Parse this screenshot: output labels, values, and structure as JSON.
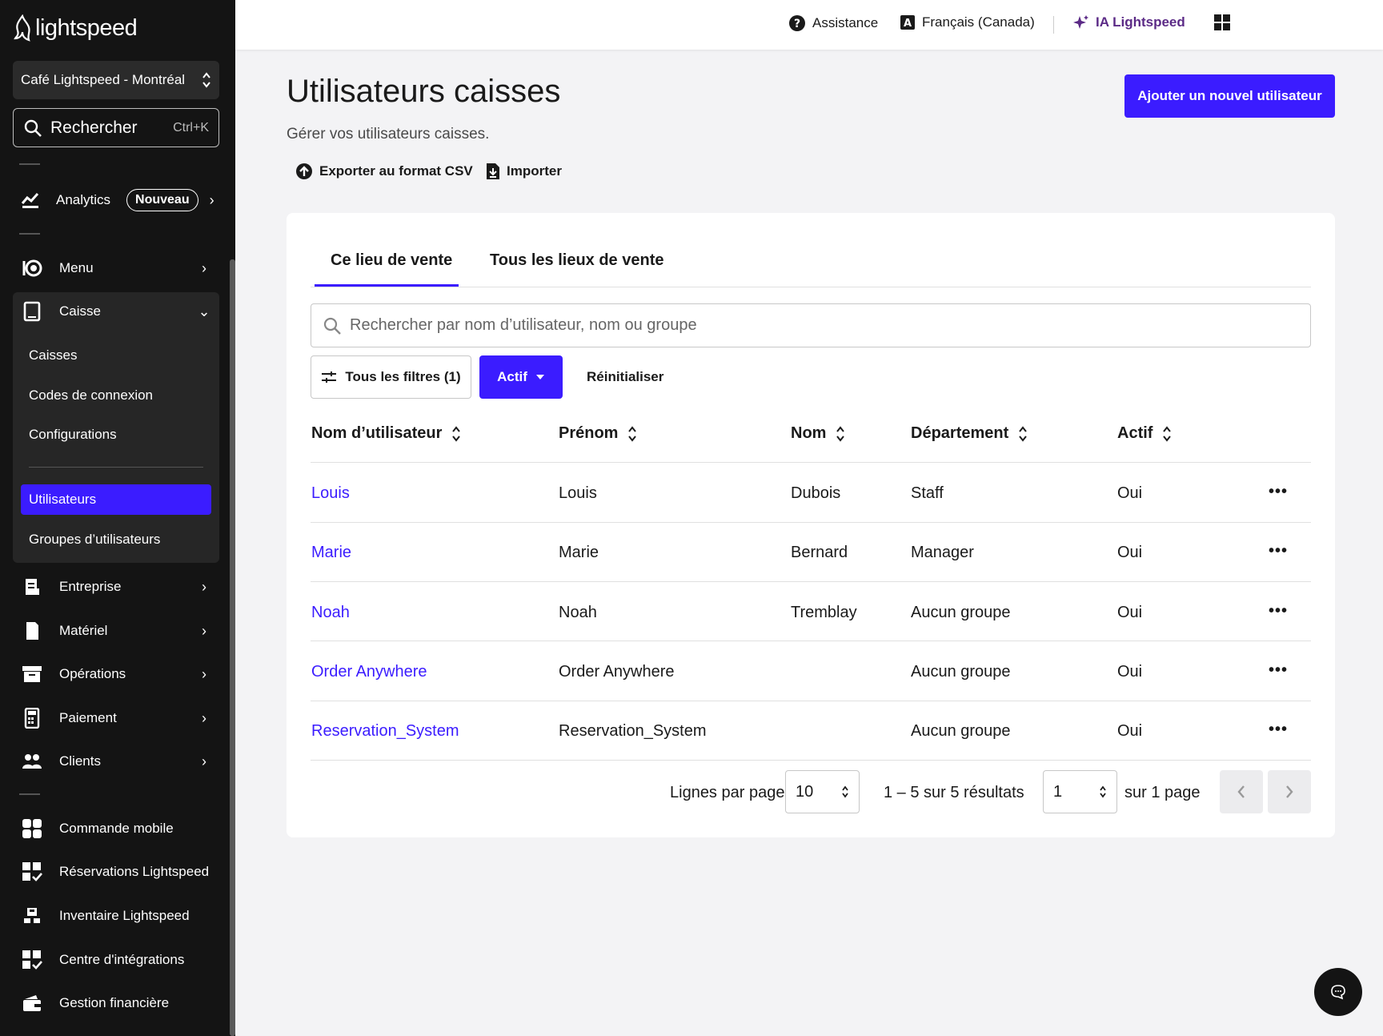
{
  "brand": {
    "name": "lightspeed"
  },
  "colors": {
    "accent": "#3b1cff",
    "sidebar_bg": "#141414",
    "ai_purple": "#5b2a86"
  },
  "sidebar": {
    "store": "Café Lightspeed - Montréal",
    "search_label": "Rechercher",
    "search_shortcut": "Ctrl+K",
    "analytics": {
      "label": "Analytics",
      "badge": "Nouveau"
    },
    "items": {
      "menu": "Menu",
      "caisse": "Caisse",
      "entreprise": "Entreprise",
      "materiel": "Matériel",
      "operations": "Opérations",
      "paiement": "Paiement",
      "clients": "Clients",
      "commande_mobile": "Commande mobile",
      "reservations": "Réservations Lightspeed",
      "inventaire": "Inventaire Lightspeed",
      "integrations": "Centre d'intégrations",
      "finance": "Gestion financière"
    },
    "caisse_sub": {
      "caisses": "Caisses",
      "codes": "Codes de connexion",
      "configurations": "Configurations",
      "utilisateurs": "Utilisateurs",
      "groupes": "Groupes d’utilisateurs"
    }
  },
  "topbar": {
    "assistance": "Assistance",
    "language": "Français (Canada)",
    "ai": "IA Lightspeed"
  },
  "page": {
    "title": "Utilisateurs caisses",
    "subtitle": "Gérer vos utilisateurs caisses.",
    "export": "Exporter au format CSV",
    "import": "Importer",
    "add_button": "Ajouter un nouvel utilisateur"
  },
  "tabs": {
    "current": "Ce lieu de vente",
    "all": "Tous les lieux de vente"
  },
  "search": {
    "placeholder": "Rechercher par nom d’utilisateur, nom ou groupe"
  },
  "filters": {
    "all": "Tous les filtres (1)",
    "active": "Actif",
    "reset": "Réinitialiser"
  },
  "table": {
    "headers": {
      "username": "Nom d’utilisateur",
      "firstname": "Prénom",
      "lastname": "Nom",
      "department": "Département",
      "active": "Actif"
    },
    "rows": [
      {
        "username": "Louis",
        "firstname": "Louis",
        "lastname": "Dubois",
        "department": "Staff",
        "active": "Oui"
      },
      {
        "username": "Marie",
        "firstname": "Marie",
        "lastname": "Bernard",
        "department": "Manager",
        "active": "Oui"
      },
      {
        "username": "Noah",
        "firstname": "Noah",
        "lastname": "Tremblay",
        "department": "Aucun groupe",
        "active": "Oui"
      },
      {
        "username": "Order Anywhere",
        "firstname": "Order Anywhere",
        "lastname": "",
        "department": "Aucun groupe",
        "active": "Oui"
      },
      {
        "username": "Reservation_System",
        "firstname": "Reservation_System",
        "lastname": "",
        "department": "Aucun groupe",
        "active": "Oui"
      }
    ],
    "more": "•••"
  },
  "pagination": {
    "rows_label": "Lignes par page",
    "rows_value": "10",
    "results": "1 – 5 sur 5 résultats",
    "page_value": "1",
    "page_total": "sur 1 page"
  }
}
